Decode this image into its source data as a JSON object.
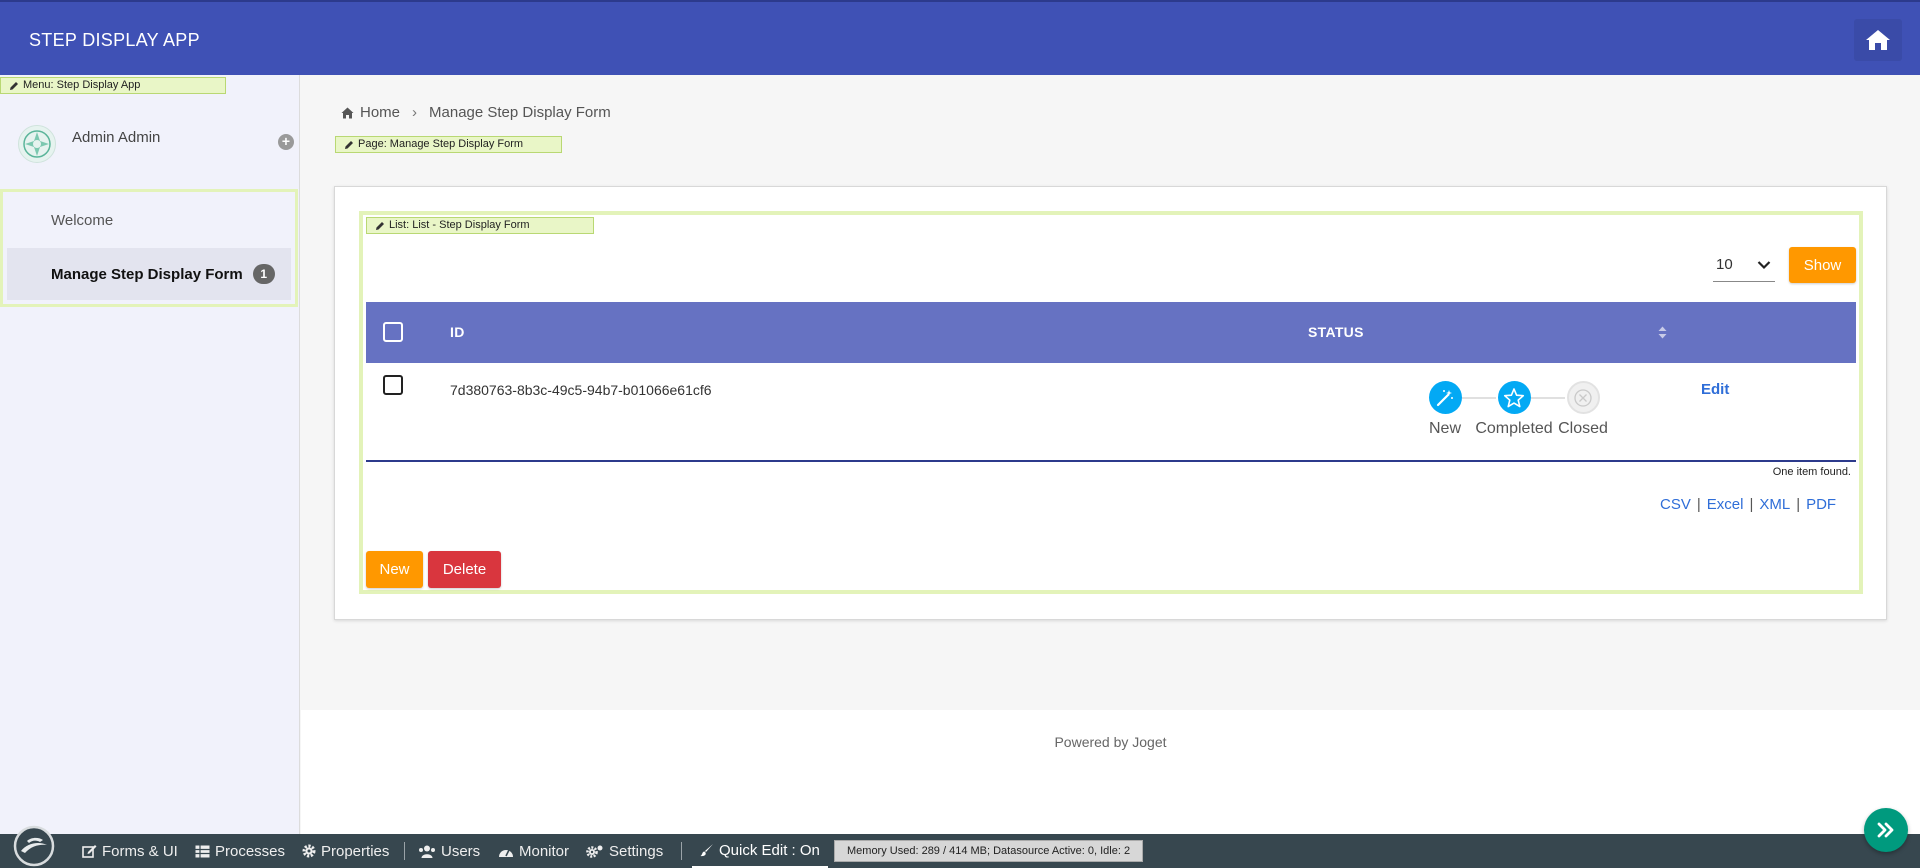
{
  "header": {
    "app_title": "STEP DISPLAY APP"
  },
  "quick_edit_tags": {
    "menu": "Menu: Step Display App",
    "page": "Page: Manage Step Display Form",
    "list": "List: List - Step Display Form"
  },
  "sidebar": {
    "user_name": "Admin Admin",
    "items": [
      {
        "label": "Welcome"
      },
      {
        "label": "Manage Step Display Form",
        "badge": "1"
      }
    ]
  },
  "breadcrumb": {
    "home": "Home",
    "current": "Manage Step Display Form"
  },
  "list": {
    "page_size": "10",
    "show_label": "Show",
    "columns": {
      "id": "ID",
      "status": "STATUS"
    },
    "rows": [
      {
        "id": "7d380763-8b3c-49c5-94b7-b01066e61cf6",
        "steps": [
          {
            "label": "New",
            "state": "done",
            "icon": "magic-wand-icon"
          },
          {
            "label": "Completed",
            "state": "current",
            "icon": "star-icon"
          },
          {
            "label": "Closed",
            "state": "pending",
            "icon": "close-circle-icon"
          }
        ],
        "action": "Edit"
      }
    ],
    "found_text": "One item found.",
    "exports": [
      "CSV",
      "Excel",
      "XML",
      "PDF"
    ],
    "export_sep": "|",
    "new_label": "New",
    "delete_label": "Delete"
  },
  "footer": {
    "text": "Powered by Joget"
  },
  "adminbar": {
    "forms": "Forms & UI",
    "processes": "Processes",
    "properties": "Properties",
    "users": "Users",
    "monitor": "Monitor",
    "settings": "Settings",
    "quick_edit": "Quick Edit : On",
    "memory": "Memory Used: 289 / 414 MB; Datasource Active: 0, Idle: 2"
  },
  "colors": {
    "header": "#3f51b5",
    "table_header": "#6672c2",
    "accent_orange": "#ff9800",
    "danger": "#d9363e",
    "step_active": "#03a9f4",
    "link": "#2f6ed8",
    "admin_bar": "#37474f"
  }
}
